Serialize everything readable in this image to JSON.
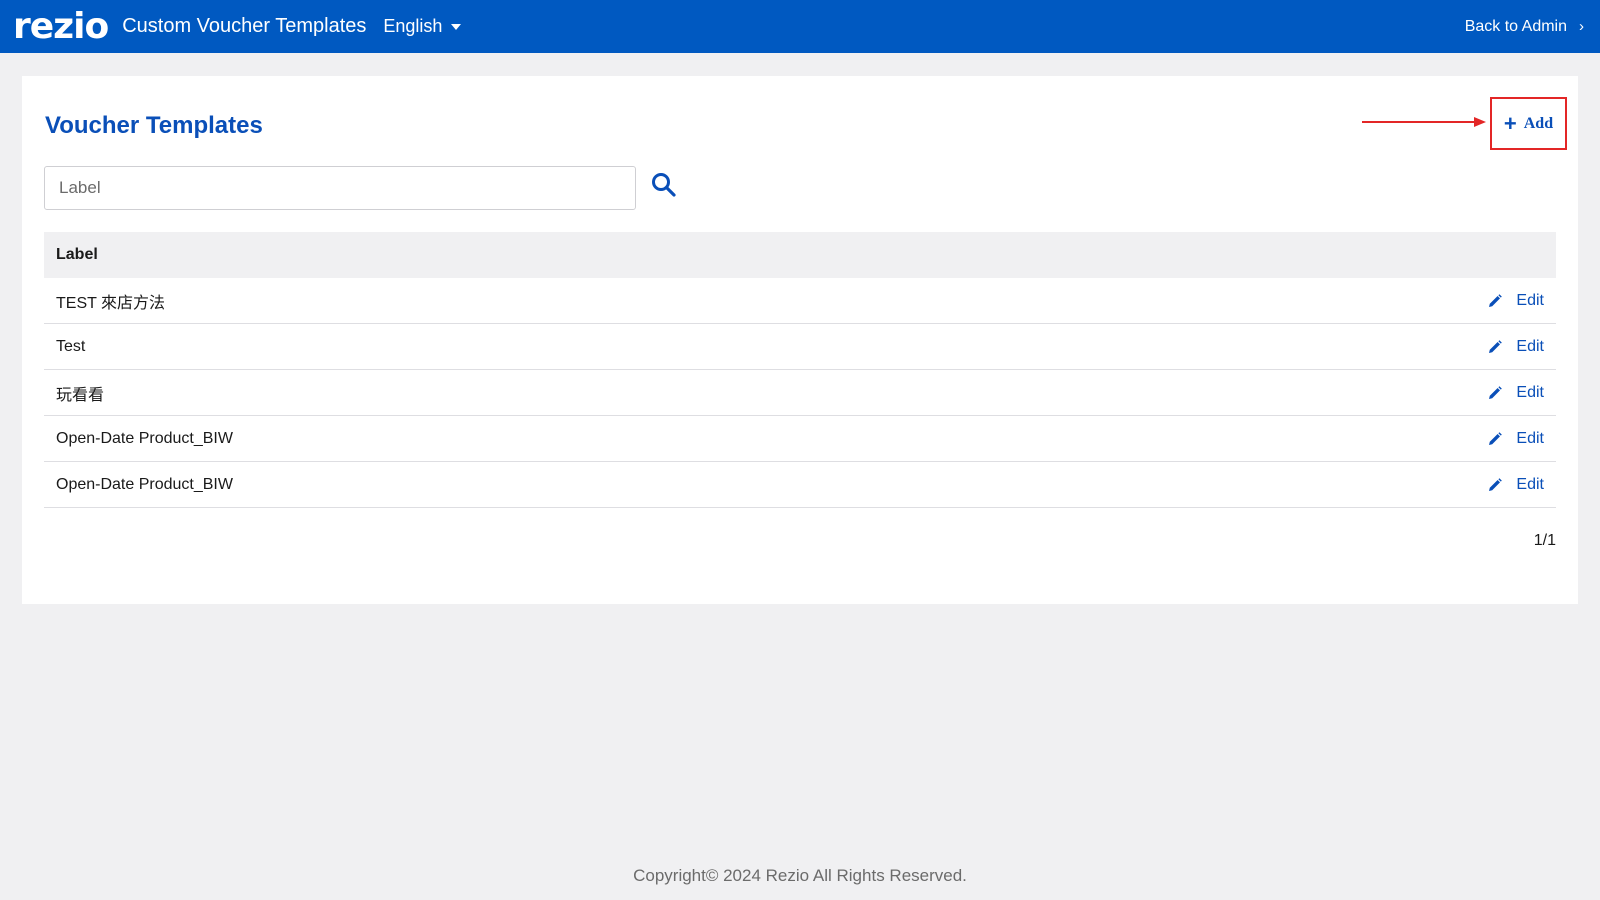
{
  "header": {
    "logo": "rezio",
    "title": "Custom Voucher Templates",
    "language": "English",
    "back_label": "Back to Admin",
    "back_icon": "chevron-right-icon"
  },
  "main": {
    "title": "Voucher Templates",
    "add_label": "Add",
    "search": {
      "placeholder": "Label",
      "value": ""
    },
    "table": {
      "column_header": "Label",
      "edit_label": "Edit",
      "rows": [
        {
          "label": "TEST 來店方法"
        },
        {
          "label": "Test"
        },
        {
          "label": "玩看看"
        },
        {
          "label": "Open-Date Product_BIW"
        },
        {
          "label": "Open-Date Product_BIW"
        }
      ]
    },
    "pagination": "1/1"
  },
  "footer": {
    "copyright": "Copyright© 2024 Rezio All Rights Reserved."
  },
  "colors": {
    "brand": "#0059c1",
    "link": "#0a4fb8",
    "highlight_annotation": "#e32626"
  }
}
